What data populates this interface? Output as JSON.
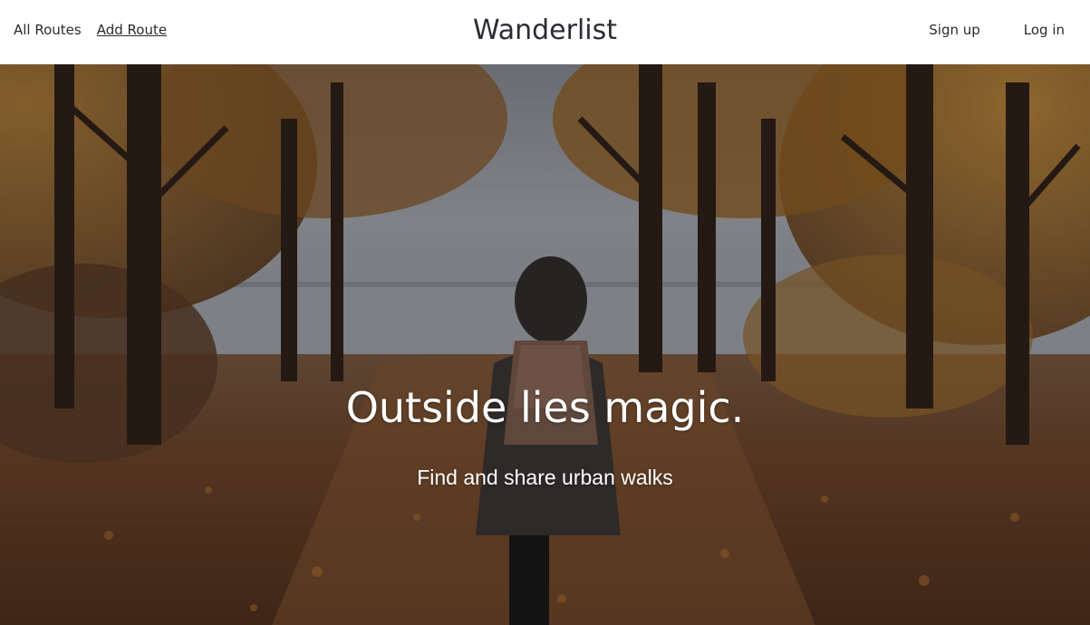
{
  "navbar": {
    "left_links": [
      {
        "label": "All Routes"
      },
      {
        "label": "Add Route"
      }
    ],
    "brand": "Wanderlist",
    "right_links": [
      {
        "label": "Sign up"
      },
      {
        "label": "Log in"
      }
    ]
  },
  "hero": {
    "title": "Outside lies magic.",
    "subtitle": "Find and share urban walks",
    "image": "autumn-forest-path-hiker-photo"
  }
}
